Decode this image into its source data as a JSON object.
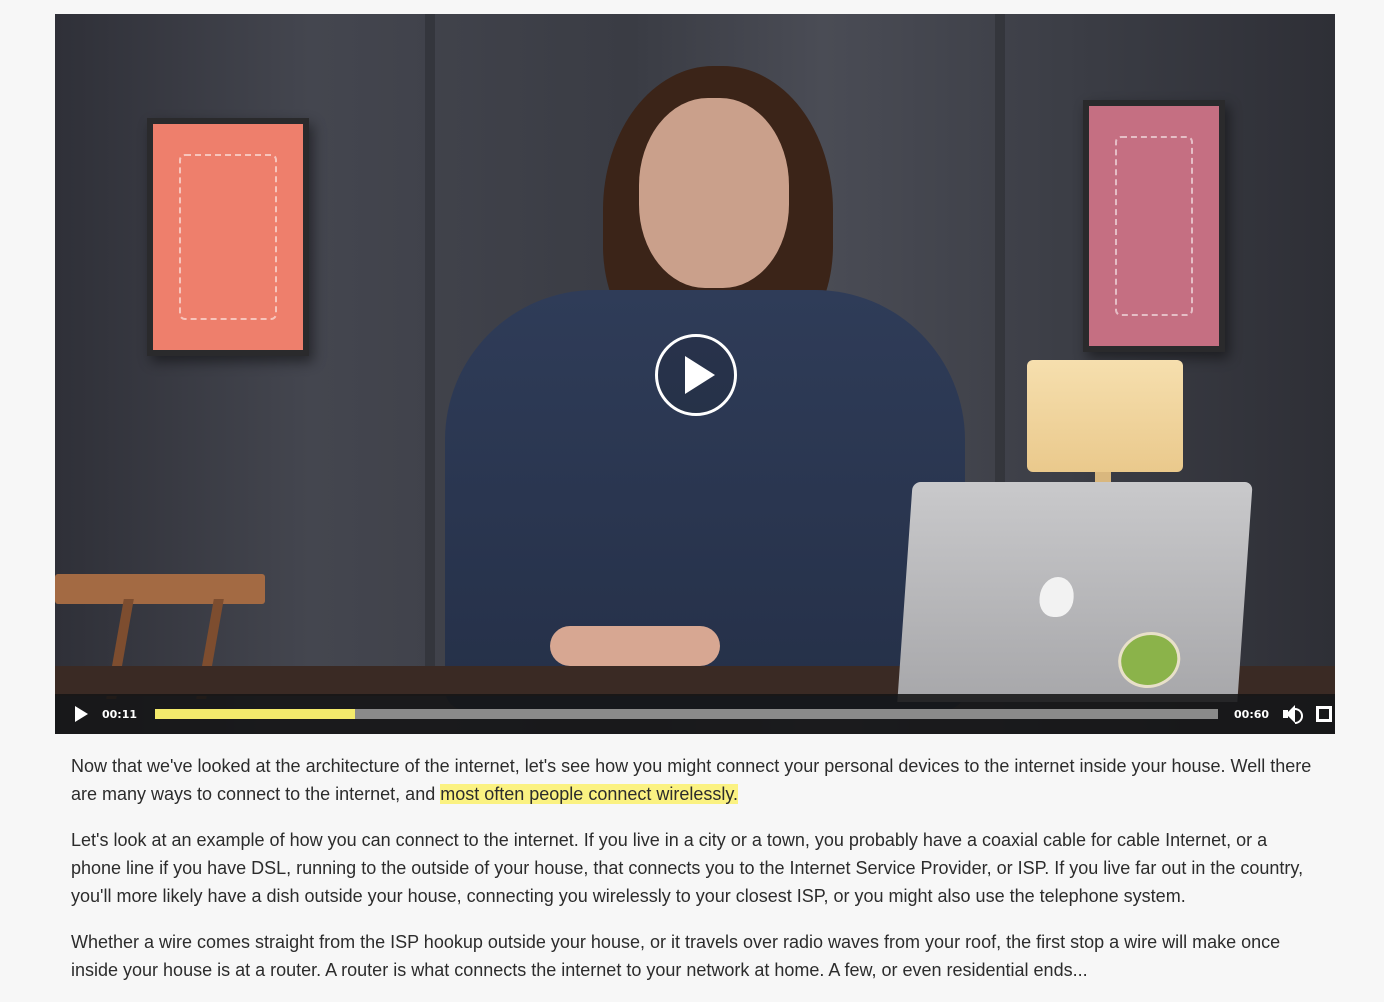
{
  "player": {
    "current_time": "00:11",
    "duration": "00:60",
    "progress_fraction": 0.188
  },
  "transcript": {
    "p1_before": "Now that we've looked at the architecture of the internet, let's see how you might connect your personal devices to the internet inside your house. Well there are many ways to connect to the internet, and ",
    "p1_highlight": "most often people connect wirelessly.",
    "p2": "Let's look at an example of how you can connect to the internet. If you live in a city or a town, you probably have a coaxial cable for cable Internet, or a phone line if you have DSL, running to the outside of your house, that connects you to the Internet Service Provider, or ISP. If you live far out in the country, you'll more likely have a dish outside your house, connecting you wirelessly to your closest ISP, or you might also use the telephone system.",
    "p3": "Whether a wire comes straight from the ISP hookup outside your house, or it travels over radio waves from your roof, the first stop a wire will make once inside your house is at a router. A router is what connects the internet to your network at home. A few, or even residential ends..."
  },
  "colors": {
    "progress_fill": "#f3ea6c",
    "progress_track": "#8a8a8a",
    "highlight": "#fbf282",
    "page_bg": "#f7f7f7"
  },
  "icons": {
    "big_play": "play-circle-icon",
    "small_play": "play-icon",
    "volume": "volume-icon",
    "fullscreen": "fullscreen-icon"
  }
}
